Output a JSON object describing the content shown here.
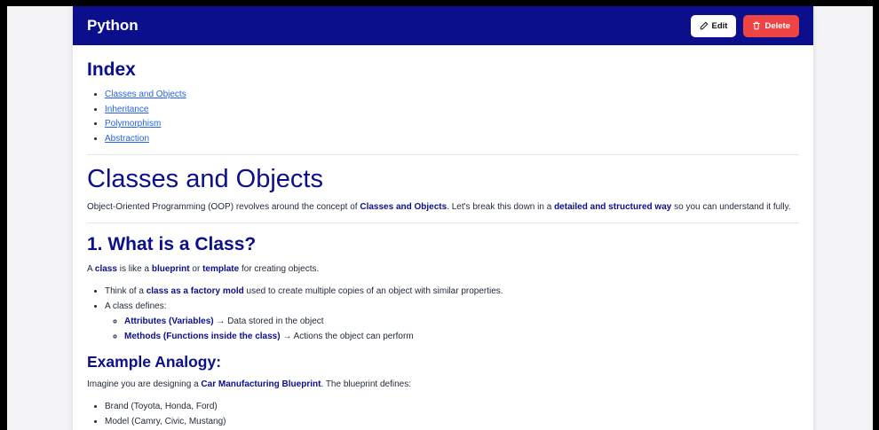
{
  "header": {
    "title": "Python",
    "edit_label": "Edit",
    "delete_label": "Delete"
  },
  "index": {
    "heading": "Index",
    "items": [
      "Classes and Objects",
      "Inheritance",
      "Polymorphism",
      "Abstraction"
    ]
  },
  "section1": {
    "title": "Classes and Objects",
    "intro": {
      "t1": "Object-Oriented Programming (OOP) revolves around the concept of ",
      "b1": "Classes and Objects",
      "t2": ". Let's break this down in a ",
      "b2": "detailed and structured way",
      "t3": " so you can understand it fully."
    }
  },
  "what_is_class": {
    "heading": "1. What is a Class?",
    "p": {
      "t1": "A ",
      "b1": "class",
      "t2": " is like a ",
      "b2": "blueprint",
      "t3": " or ",
      "b3": "template",
      "t4": " for creating objects."
    },
    "bullet1": {
      "t1": "Think of a ",
      "b1": "class as a factory mold",
      "t2": " used to create multiple copies of an object with similar properties."
    },
    "bullet2": "A class defines:",
    "sub1": {
      "b": "Attributes (Variables)",
      "t": " → Data stored in the object"
    },
    "sub2": {
      "b": "Methods (Functions inside the class)",
      "t": " → Actions the object can perform"
    }
  },
  "analogy": {
    "heading": "Example Analogy:",
    "p": {
      "t1": "Imagine you are designing a ",
      "b1": "Car Manufacturing Blueprint",
      "t2": ". The blueprint defines:"
    },
    "items": [
      "Brand (Toyota, Honda, Ford)",
      "Model (Camry, Civic, Mustang)"
    ]
  },
  "icons": {
    "edit": "pencil-icon",
    "delete": "trash-icon"
  },
  "colors": {
    "header_bg": "#0b0f8c",
    "delete_bg": "#ef4444",
    "link": "#2563eb",
    "heading": "#0b0f8c"
  }
}
